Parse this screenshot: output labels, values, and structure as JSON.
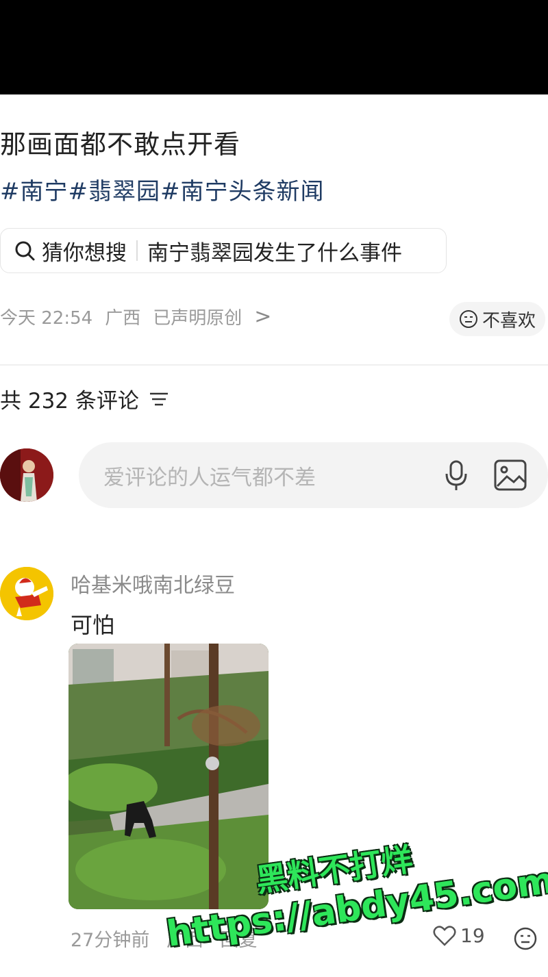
{
  "post": {
    "title": "那画面都不敢点开看",
    "hashtags": "#南宁#翡翠园#南宁头条新闻"
  },
  "suggest": {
    "label": "猜你想搜",
    "term": "南宁翡翠园发生了什么事件"
  },
  "meta": {
    "time": "今天 22:54",
    "location": "广西",
    "original": "已声明原创",
    "chevron": ">",
    "dislike": "不喜欢"
  },
  "comments": {
    "count_label": "共 232 条评论",
    "input_placeholder": "爱评论的人运气都不差"
  },
  "comment1": {
    "username": "哈基米哦南北绿豆",
    "text": "可怕",
    "time": "27分钟前",
    "location": "广西",
    "reply": "回复",
    "likes": "19"
  },
  "watermark": {
    "line1": "黑料不打烊",
    "line2": "https://abdy45.com"
  },
  "colors": {
    "hashtag": "#1f3b63",
    "watermark": "#2ee65a",
    "muted": "#9a9a9a"
  },
  "icons": [
    "search-icon",
    "chevron-right-icon",
    "neutral-face-icon",
    "filter-icon",
    "microphone-icon",
    "image-icon",
    "heart-icon"
  ]
}
